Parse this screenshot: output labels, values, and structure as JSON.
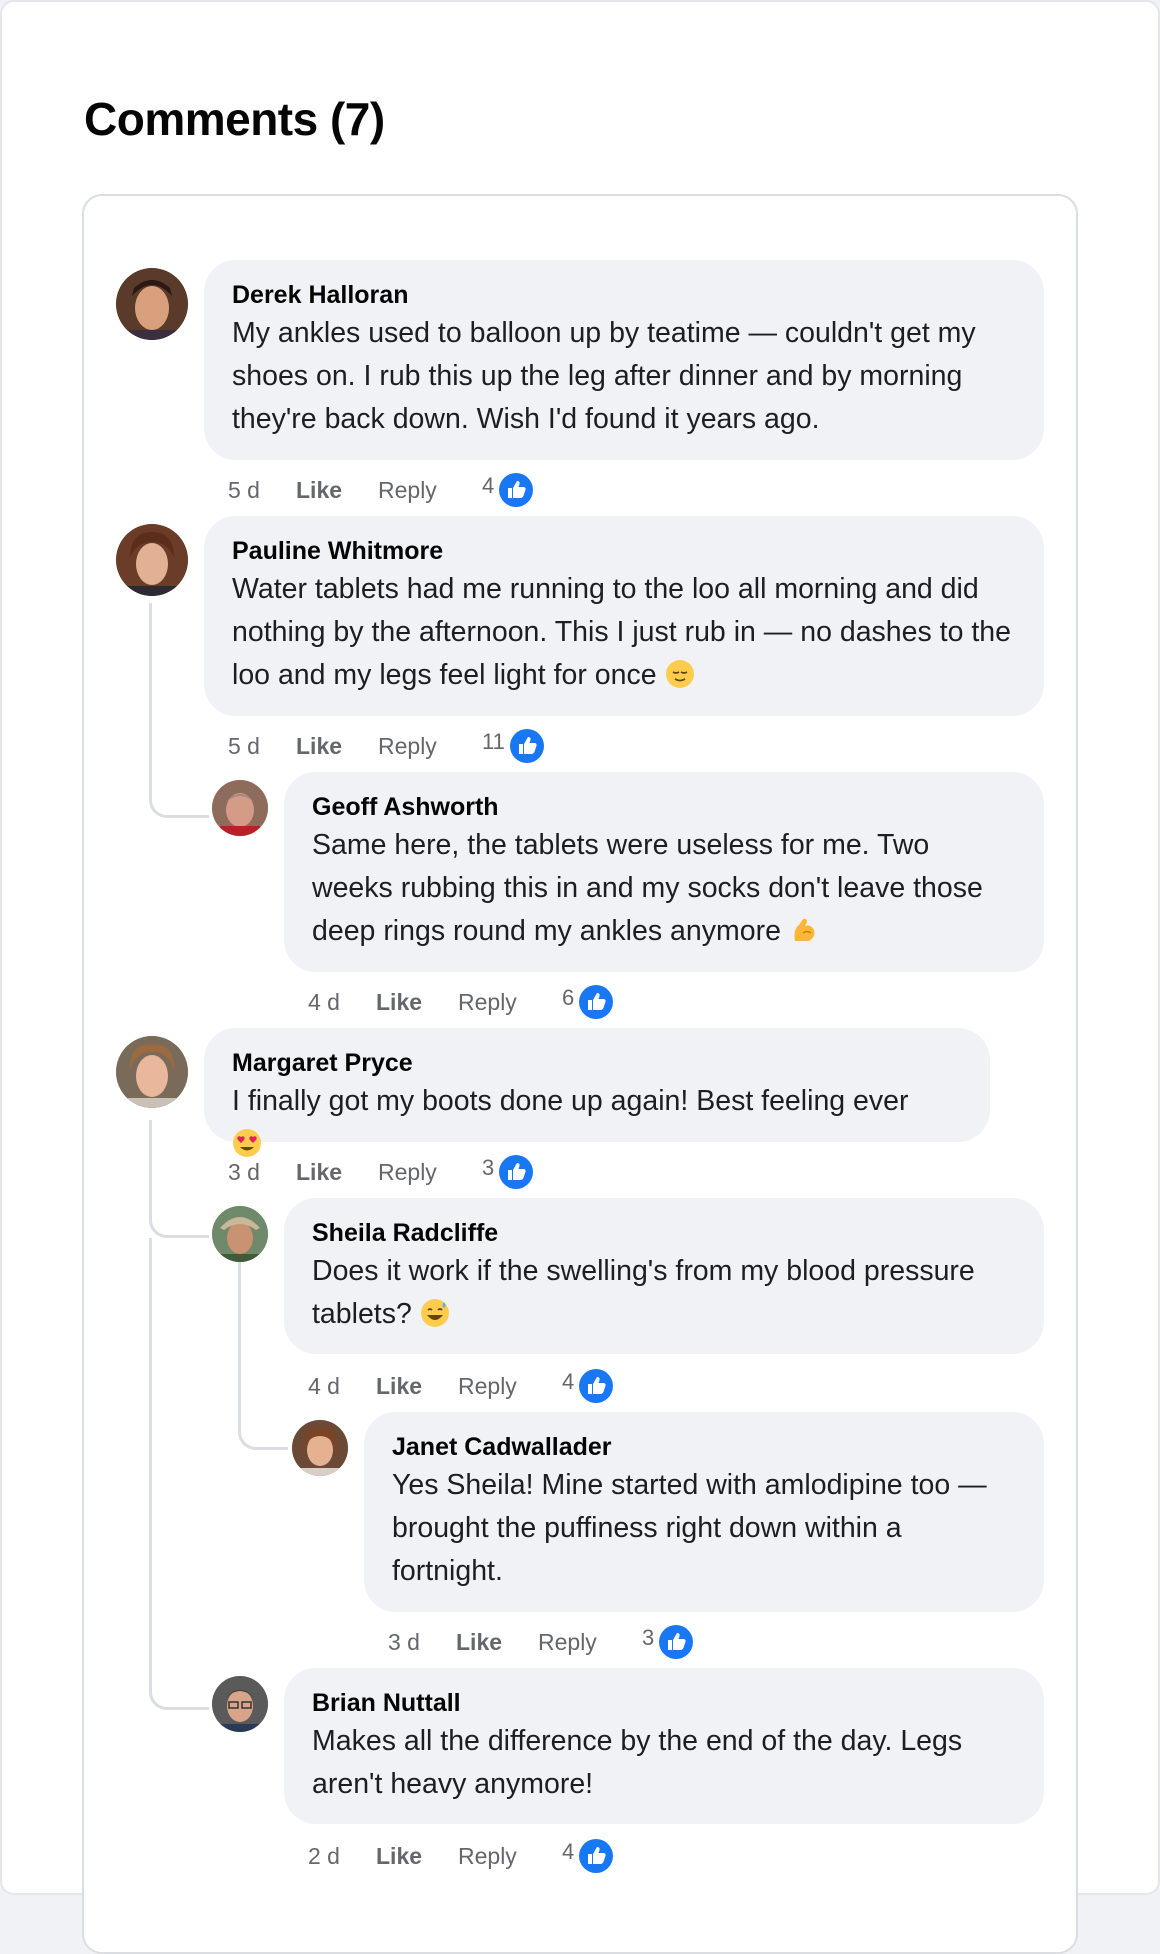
{
  "heading": "Comments (7)",
  "comments": [
    {
      "author": "Derek Halloran",
      "text": "My ankles used to balloon up by teatime — couldn't get my shoes on. I rub this up the leg after dinner and by morning they're back down. Wish I'd found it years ago.",
      "time": "5 d",
      "like_label": "Like",
      "reply_label": "Reply",
      "likes": "4"
    },
    {
      "author": "Pauline Whitmore",
      "text": "Water tablets had me running to the loo all morning and did nothing by the afternoon. This I just rub in — no dashes to the loo and my legs feel light for once",
      "emoji": "relieved-face",
      "time": "5 d",
      "like_label": "Like",
      "reply_label": "Reply",
      "likes": "11"
    },
    {
      "author": "Geoff Ashworth",
      "text": "Same here, the tablets were useless for me. Two weeks rubbing this in and my socks don't leave those deep rings round my ankles anymore",
      "emoji": "flexed-biceps",
      "time": "4 d",
      "like_label": "Like",
      "reply_label": "Reply",
      "likes": "6"
    },
    {
      "author": "Margaret Pryce",
      "text": "I finally got my boots done up again! Best feeling ever",
      "emoji": "heart-eyes-face",
      "time": "3 d",
      "like_label": "Like",
      "reply_label": "Reply",
      "likes": "3"
    },
    {
      "author": "Sheila Radcliffe",
      "text": "Does it work if the swelling's from my blood pressure tablets?",
      "emoji": "grinning-sweat-face",
      "time": "4 d",
      "like_label": "Like",
      "reply_label": "Reply",
      "likes": "4"
    },
    {
      "author": "Janet Cadwallader",
      "text": "Yes Sheila! Mine started with amlodipine too — brought the puffiness right down within a fortnight.",
      "time": "3 d",
      "like_label": "Like",
      "reply_label": "Reply",
      "likes": "3"
    },
    {
      "author": "Brian Nuttall",
      "text": "Makes all the difference by the end of the day. Legs aren't heavy anymore!",
      "time": "2 d",
      "like_label": "Like",
      "reply_label": "Reply",
      "likes": "4"
    }
  ],
  "colors": {
    "bubble": "#f0f2f5",
    "like_blue": "#1877f2",
    "muted_text": "#65676b",
    "thread_line": "#dadde1"
  },
  "icons": [
    "thumbs-up-like-icon",
    "avatar-photo"
  ]
}
